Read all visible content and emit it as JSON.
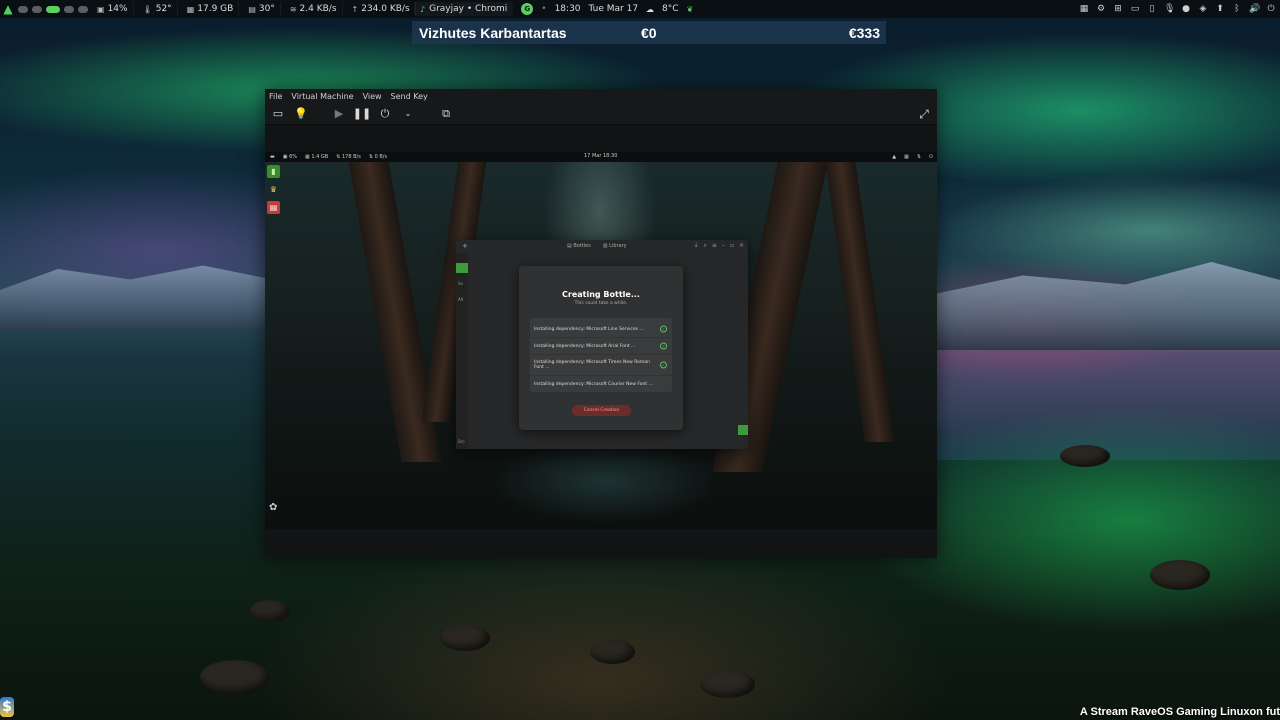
{
  "top_panel": {
    "cpu": "14%",
    "temp": "52°",
    "memory": "17.9 GB",
    "gpu_temp": "30°",
    "upload": "2.4 KB/s",
    "download": "234.0 KB/s",
    "active_task": "Grayjay • Chromi",
    "app_badge": "G",
    "time": "18:30",
    "date": "Tue Mar 17",
    "weather": "8°C"
  },
  "ticker": {
    "name": "Vizhutes Karbantartas",
    "value1": "€0",
    "value2": "€333"
  },
  "vm_window": {
    "menu": [
      "File",
      "Virtual Machine",
      "View",
      "Send Key"
    ],
    "guest": {
      "panel": {
        "cpu": "6%",
        "memory": "1.4 GB",
        "net_down": "178 B/s",
        "net_up": "0 B/s",
        "clock": "17 Mar 18:30"
      },
      "bottles": {
        "tabs": [
          "Bottles",
          "Library"
        ],
        "sidebar_fragments": [
          "Se",
          "All",
          "Bro"
        ],
        "dialog": {
          "title": "Creating Bottle...",
          "subtitle": "This could take a while.",
          "dependencies": [
            {
              "label": "Installing dependency: Microsoft Line Services ...",
              "done": true
            },
            {
              "label": "Installing dependency: Microsoft Arial Font ...",
              "done": true
            },
            {
              "label": "Installing dependency: Microsoft Times New Roman Font ...",
              "done": true
            },
            {
              "label": "Installing dependency: Microsoft Courier New Font ...",
              "done": false
            }
          ],
          "cancel_label": "Cancel Creation"
        }
      }
    }
  },
  "stream_caption": "A Stream RaveOS Gaming Linuxon fut",
  "colors": {
    "accent_green": "#5ed05e",
    "ticker_bg": "#1e3750",
    "cancel_bg": "#6b2c2c",
    "success": "#57c35d"
  }
}
